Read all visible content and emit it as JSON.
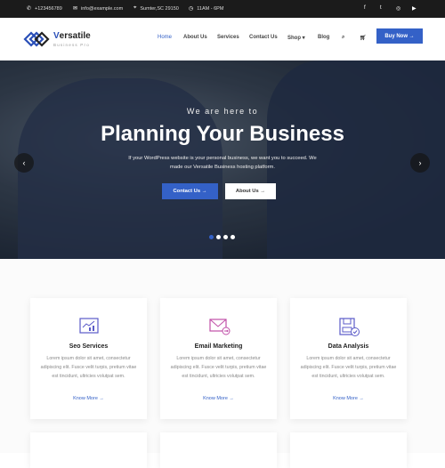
{
  "topbar": {
    "phone": "+123456789",
    "email": "info@example.com",
    "address": "Sumter,SC 29150",
    "hours": "11AM - 6PM",
    "social": [
      "facebook",
      "twitter",
      "instagram",
      "youtube"
    ]
  },
  "header": {
    "brand_first": "V",
    "brand_rest": "ersatile",
    "tagline": "Business Pro",
    "nav": [
      "Home",
      "About Us",
      "Services",
      "Contact Us",
      "Shop",
      "Blog"
    ],
    "buy": "Buy Now →"
  },
  "hero": {
    "subtitle": "We are here to",
    "title": "Planning Your Business",
    "text": "If your WordPress website is your personal business, we want you to succeed. We made our Versatile Business hosting platform.",
    "contact": "Contact Us →",
    "about": "About Us →",
    "prev": "‹",
    "next": "›"
  },
  "cards": [
    {
      "title": "Seo Services",
      "text": "Lorem ipsum dolor sit amet, consectetur adipiscing elit. Fusce velit turpis, pretium vitae est tincidunt, ultricies volutpat sem.",
      "link": "Know More →"
    },
    {
      "title": "Email Marketing",
      "text": "Lorem ipsum dolor sit amet, consectetur adipiscing elit. Fusce velit turpis, pretium vitae est tincidunt, ultricies volutpat sem.",
      "link": "Know More →"
    },
    {
      "title": "Data Analysis",
      "text": "Lorem ipsum dolor sit amet, consectetur adipiscing elit. Fusce velit turpis, pretium vitae est tincidunt, ultricies volutpat sem.",
      "link": "Know More →"
    }
  ],
  "colors": {
    "accent": "#3461c7",
    "topbar": "#1b1b1b"
  }
}
